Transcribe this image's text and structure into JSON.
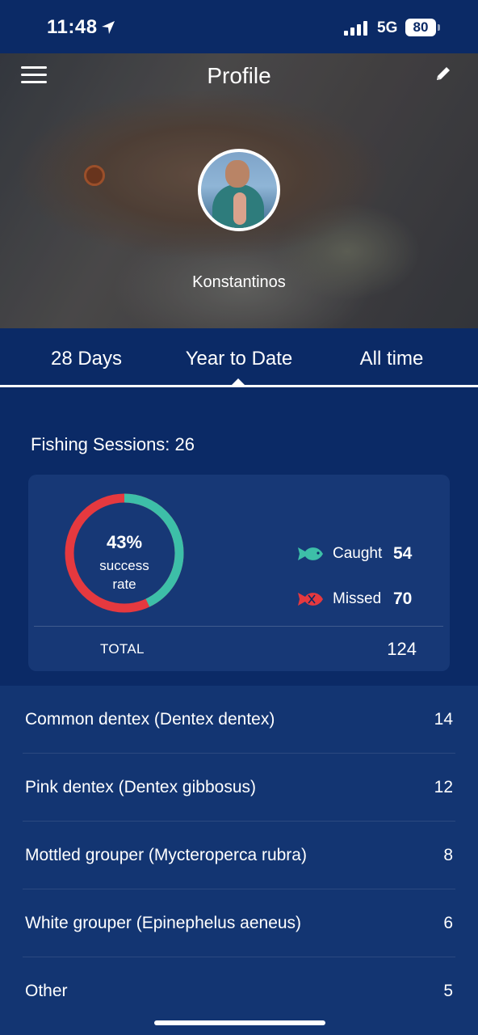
{
  "status_bar": {
    "time": "11:48",
    "network": "5G",
    "battery": "80"
  },
  "header": {
    "title": "Profile",
    "username": "Konstantinos"
  },
  "tabs": [
    {
      "label": "28 Days"
    },
    {
      "label": "Year to Date",
      "selected": true
    },
    {
      "label": "All time"
    }
  ],
  "summary": {
    "sessions_text": "Fishing Sessions: 26",
    "success_rate": "43%",
    "success_label": "success rate",
    "success_fraction": 0.43,
    "caught_label": "Caught",
    "caught_value": "54",
    "missed_label": "Missed",
    "missed_value": "70",
    "total_label": "TOTAL",
    "total_value": "124"
  },
  "species": [
    {
      "name": "Common dentex (Dentex dentex)",
      "count": "14"
    },
    {
      "name": "Pink dentex (Dentex gibbosus)",
      "count": "12"
    },
    {
      "name": "Mottled grouper (Mycteroperca rubra)",
      "count": "8"
    },
    {
      "name": "White grouper (Epinephelus aeneus)",
      "count": "6"
    },
    {
      "name": "Other",
      "count": "5"
    }
  ],
  "colors": {
    "background": "#0b2a66",
    "card": "#173876",
    "list": "#133572",
    "caught": "#3dbfa8",
    "missed": "#e5393f"
  },
  "icons": [
    "location-arrow-icon",
    "signal-icon",
    "battery-icon",
    "menu-icon",
    "edit-pencil-icon",
    "fish-caught-icon",
    "fish-missed-icon"
  ]
}
